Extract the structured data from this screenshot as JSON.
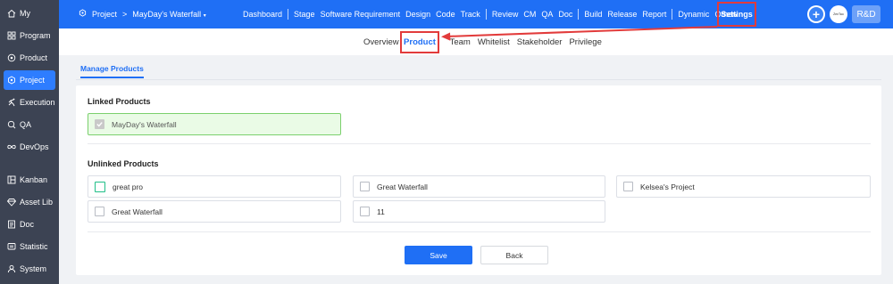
{
  "sidebar": {
    "items": [
      {
        "label": "My",
        "icon": "home-icon"
      },
      {
        "label": "Program",
        "icon": "grid-icon"
      },
      {
        "label": "Product",
        "icon": "product-icon"
      },
      {
        "label": "Project",
        "icon": "project-icon",
        "active": true
      },
      {
        "label": "Execution",
        "icon": "run-icon"
      },
      {
        "label": "QA",
        "icon": "qa-icon"
      },
      {
        "label": "DevOps",
        "icon": "infinity-icon"
      },
      {
        "label": "Kanban",
        "icon": "kanban-icon"
      },
      {
        "label": "Asset Lib",
        "icon": "diamond-icon"
      },
      {
        "label": "Doc",
        "icon": "doc-icon"
      },
      {
        "label": "Statistic",
        "icon": "chart-icon"
      },
      {
        "label": "System",
        "icon": "user-icon"
      }
    ]
  },
  "header": {
    "breadcrumb_root": "Project",
    "breadcrumb_separator": ">",
    "breadcrumb_current": "MayDay's Waterfall",
    "nav_groups": [
      [
        "Dashboard"
      ],
      [
        "Stage",
        "Software Requirement",
        "Design",
        "Code",
        "Track"
      ],
      [
        "Review",
        "CM",
        "QA",
        "Doc"
      ],
      [
        "Build",
        "Release",
        "Report"
      ],
      [
        "Dynamic",
        "Other"
      ]
    ],
    "settings_label": "Settings",
    "avatar_text": "ZenTao",
    "rd_label": "R&D",
    "colors": {
      "bar": "#1f6ff5",
      "highlight": "#e23b3b"
    }
  },
  "subnav": {
    "before": [
      "Overview"
    ],
    "active": "Product",
    "after": [
      "Team",
      "Whitelist",
      "Stakeholder",
      "Privilege"
    ]
  },
  "tabs": {
    "manage_products": "Manage Products"
  },
  "linked": {
    "title": "Linked Products",
    "products": [
      "MayDay's Waterfall"
    ]
  },
  "unlinked": {
    "title": "Unlinked Products",
    "products": [
      "great pro",
      "Great Waterfall",
      "Kelsea's Project",
      "Great Waterfall",
      "11"
    ]
  },
  "actions": {
    "save": "Save",
    "back": "Back"
  }
}
